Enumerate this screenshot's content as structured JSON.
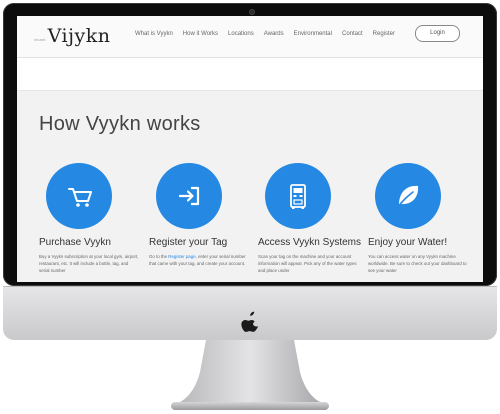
{
  "site": {
    "logo_small": "vivant",
    "logo": "Vijykn"
  },
  "nav": {
    "links": [
      "What is Vyykn",
      "How it Works",
      "Locations",
      "Awards",
      "Environmental",
      "Contact",
      "Register"
    ],
    "login_label": "Login"
  },
  "main": {
    "heading": "How Vyykn works",
    "steps": [
      {
        "icon": "shopping-cart-icon",
        "title": "Purchase Vyykn",
        "text": "Buy a Vyykn subscription at your local gym, airport, restaurant, etc. It will include a bottle, tag, and serial number"
      },
      {
        "icon": "sign-in-icon",
        "title": "Register your Tag",
        "text_before": "Go to the ",
        "text_link": "Register page",
        "text_after": ", enter your serial number that came with your tag, and create your account."
      },
      {
        "icon": "vending-machine-icon",
        "title": "Access Vyykn Systems",
        "text": "Scan your tag on the machine and your account information will appear. Pick any of the water types and place under"
      },
      {
        "icon": "leaf-icon",
        "title": "Enjoy your Water!",
        "text": "You can access water on any Vyykn machine worldwide. Be sure to check out your dashboard to see your water"
      }
    ]
  },
  "colors": {
    "accent": "#2589e3",
    "bezel": "#0c0c0c",
    "chin": "#d8d8da"
  },
  "device": {
    "brand_icon": "apple-logo-icon"
  }
}
